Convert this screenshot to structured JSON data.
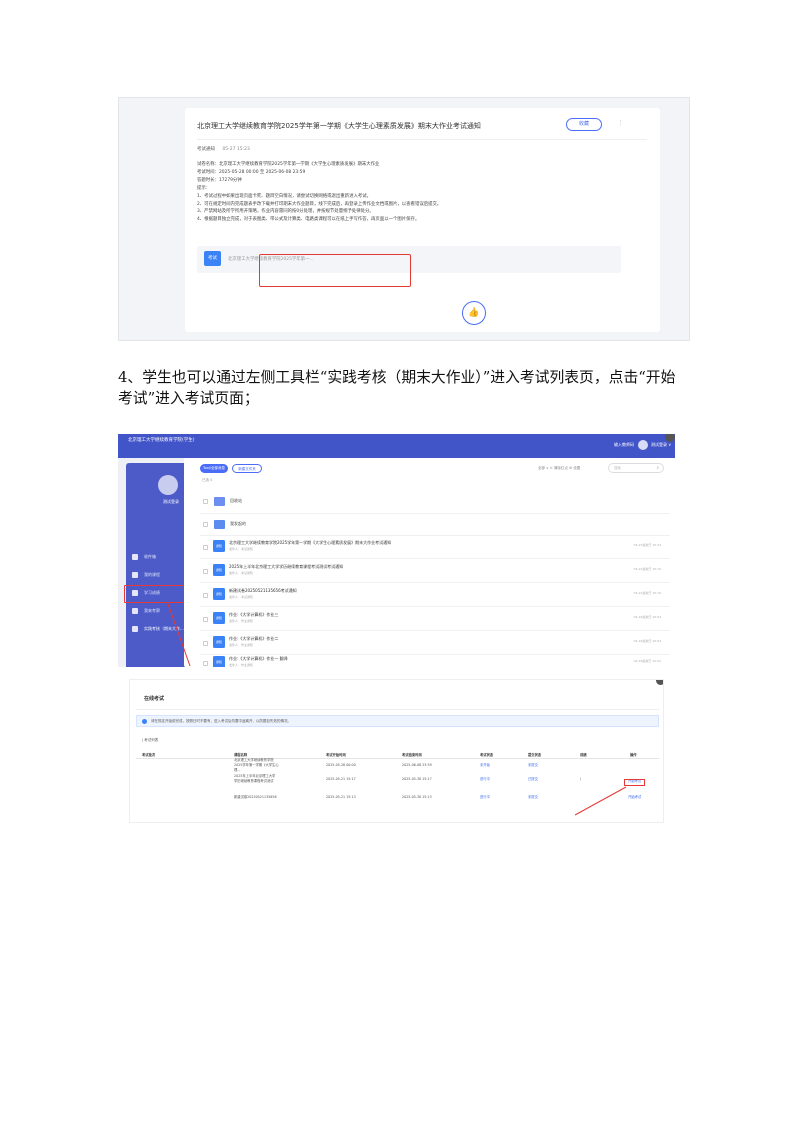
{
  "notice": {
    "title": "北京理工大学继续教育学院2025学年第一学期《大学生心理素质发展》期末大作业考试通知",
    "collect_label": "收藏",
    "more_label": "⋮",
    "type_label": "考试通知",
    "date": "05-27 15:23",
    "body": [
      "试卷名称：北京理工大学继续教育学院2025学年第一学期《大学生心理素质发展》期末大作业",
      "考试时间：2025-05-28 00:00 至 2025-06-08 23:59",
      "答题时长：17279分钟",
      "提示：",
      "1、考试过程中如果出现页面卡死、题目空白情况，请尝试切换网络或退出重新进入考试。",
      "2、可在规定时间内完成题表手改下载并打印期末大作业题目，线下完成后，再登录上传作业文档或图片，以查看错误后提交。",
      "3、严禁网站及所学所用开策略，作业内容雷同的按0分处理，并按规节处量纲予处律处分。",
      "4、根据题目独立完成，对于表图类、带公式及计算类、电路类课程可以在纸上手写作答，再页面以一个图片保存。"
    ],
    "attachment_badge": "考试",
    "attachment_name": "北京理工大学继续教育学院2025学年第一...",
    "like_icon": "thumbs-up-icon"
  },
  "paragraph": "4、学生也可以通过左侧工具栏“实践考核（期末大作业）”进入考试列表页，点击“开始考试”进入考试页面；",
  "app": {
    "school_name": "北京理工大学继续教育学院(学生)",
    "top_user_label": "输入教师码",
    "top_username": "测试登录 ∨",
    "side_username": "测试登录",
    "side_items": [
      "收件箱",
      "我的课程",
      "学习成绩",
      "我来考察",
      "实践考核（期末大作...)"
    ],
    "pill_1": "Tool/全部消息",
    "pill_2": "新建文件夹",
    "tool_right": "全部 ∨   ⊙ 清除红点   ⚙ 设置",
    "search_placeholder": "搜索",
    "selected_label": "已选 0",
    "folders": [
      "回收站",
      "我发起的"
    ],
    "docs": [
      {
        "badge": "通知",
        "title": "北京理工大学继续教育学院2025学年第一学期《大学生心理素质发展》期末大作业考试通知",
        "sub": "发件人：考试通知",
        "time": "05-27最新已 15:23"
      },
      {
        "badge": "通知",
        "title": "2025年上半年北京理工大学学历继续教育课程考试测试考试通知",
        "sub": "发件人：考试通知",
        "time": "05-21最新已 15:15"
      },
      {
        "badge": "通知",
        "title": "新建试卷20250521135656考试通知",
        "sub": "发件人：考试通知",
        "time": "05-21最新已 15:10"
      },
      {
        "badge": "通知",
        "title": "作业:《大学计算机》作业三",
        "sub": "发件人：作业通知",
        "time": "04-16最新已 16:04"
      },
      {
        "badge": "通知",
        "title": "作业:《大学计算机》作业二",
        "sub": "发件人：作业通知",
        "time": "04-16最新已 16:04"
      },
      {
        "badge": "通知",
        "title": "作业:《大学计算机》作业一 翻译",
        "sub": "发件人：作业通知",
        "time": "04-16最新已 15:52"
      }
    ]
  },
  "exam_list": {
    "page_title": "在线考试",
    "info_text": "请在规定开始前完成，按照日时不要有，进入考试后勿要中途离开，以防题目失效的情况。",
    "list_label": "| 考试列表",
    "headers": [
      "考试批次",
      "课程名称",
      "考试开始时间",
      "考试结束时间",
      "考试状态",
      "提交状态",
      "成绩",
      "操作"
    ],
    "rows": [
      {
        "course": [
          "北京理工大学继续教育学院",
          "2025学年第一学期《大学生心",
          "理..."
        ],
        "start": "2025-05-28 00:00",
        "end": "2025-06-08 23:59",
        "status": "未开始",
        "submit": "未提交",
        "score": "",
        "action": ""
      },
      {
        "course": [
          "2025年上半年北京理工大学",
          "学历继续教育课程考试测试"
        ],
        "start": "2025-05-21 15:17",
        "end": "2025-05-30 15:17",
        "status": "进行中",
        "submit": "已提交",
        "score": "/",
        "action": "开始考试"
      },
      {
        "course": [
          "新建试卷20250521135656"
        ],
        "start": "2025-05-21 15:13",
        "end": "2025-05-30 15:13",
        "status": "进行中",
        "submit": "未提交",
        "score": "",
        "action": "开始考试"
      }
    ]
  },
  "colors": {
    "accent": "#4a6cf7",
    "highlight": "#e53935",
    "sidebar": "#4c5bc8",
    "topbar": "#4255c8"
  }
}
